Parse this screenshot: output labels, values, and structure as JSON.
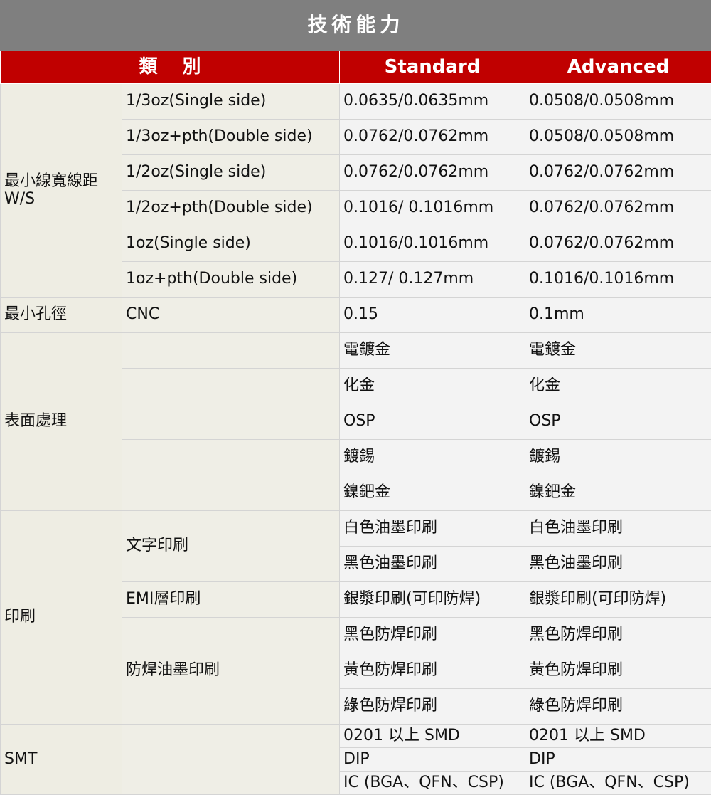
{
  "title": "技術能力",
  "header": {
    "category": "類　 別",
    "standard": "Standard",
    "advanced": "Advanced"
  },
  "sections": {
    "ws": {
      "label1": "最小線寬線距",
      "label2": "W/S",
      "rows": [
        {
          "sub": "1/3oz(Single side)",
          "std": "0.0635/0.0635mm",
          "adv": "0.0508/0.0508mm"
        },
        {
          "sub": "1/3oz+pth(Double side)",
          "std": "0.0762/0.0762mm",
          "adv": "0.0508/0.0508mm"
        },
        {
          "sub": "1/2oz(Single side)",
          "std": "0.0762/0.0762mm",
          "adv": "0.0762/0.0762mm"
        },
        {
          "sub": "1/2oz+pth(Double side)",
          "std": "0.1016/ 0.1016mm",
          "adv": "0.0762/0.0762mm"
        },
        {
          "sub": "1oz(Single side)",
          "std": "0.1016/0.1016mm",
          "adv": "0.0762/0.0762mm"
        },
        {
          "sub": "1oz+pth(Double side)",
          "std": "0.127/ 0.127mm",
          "adv": "0.1016/0.1016mm"
        }
      ]
    },
    "hole": {
      "label": "最小孔徑",
      "sub": "CNC",
      "std": "0.15",
      "adv": "0.1mm"
    },
    "surface": {
      "label": "表面處理",
      "rows": [
        {
          "std": "電鍍金",
          "adv": "電鍍金"
        },
        {
          "std": "化金",
          "adv": "化金"
        },
        {
          "std": "OSP",
          "adv": "OSP"
        },
        {
          "std": "鍍錫",
          "adv": "鍍錫"
        },
        {
          "std": "鎳鈀金",
          "adv": "鎳鈀金"
        }
      ]
    },
    "printing": {
      "label": "印刷",
      "text_sub": "文字印刷",
      "text_rows": [
        {
          "std": "白色油墨印刷",
          "adv": "白色油墨印刷"
        },
        {
          "std": "黑色油墨印刷",
          "adv": "黑色油墨印刷"
        }
      ],
      "emi_sub": "EMI層印刷",
      "emi_row": {
        "std": "銀漿印刷(可印防焊)",
        "adv": "銀漿印刷(可印防焊)"
      },
      "mask_sub": "防焊油墨印刷",
      "mask_rows": [
        {
          "std": "黑色防焊印刷",
          "adv": "黑色防焊印刷"
        },
        {
          "std": "黃色防焊印刷",
          "adv": "黃色防焊印刷"
        },
        {
          "std": "綠色防焊印刷",
          "adv": "綠色防焊印刷"
        }
      ]
    },
    "smt": {
      "label": "SMT",
      "rows": [
        {
          "std": "0201 以上 SMD",
          "adv": "0201 以上 SMD"
        },
        {
          "std": "DIP",
          "adv": "DIP"
        },
        {
          "std": "IC (BGA、QFN、CSP)",
          "adv": "IC (BGA、QFN、CSP)"
        }
      ]
    }
  },
  "colors": {
    "title_bg": "#7f7f7f",
    "header_bg": "#c00000",
    "category_bg": "#eeede3",
    "value_bg": "#f3f3f3"
  }
}
